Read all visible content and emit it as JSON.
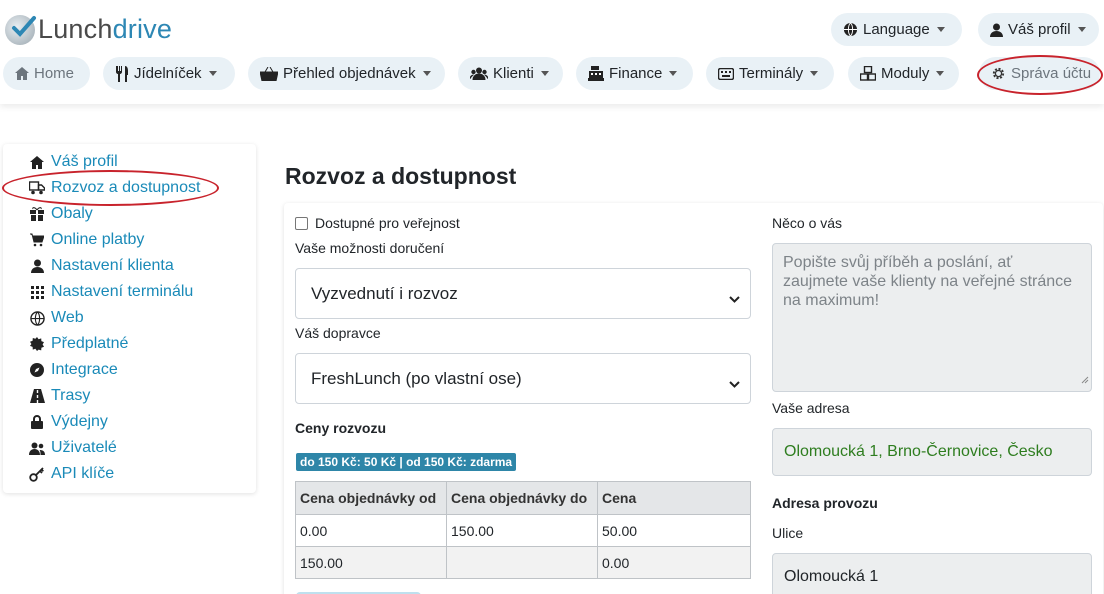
{
  "logo": {
    "part1": "Lunch",
    "part2": "drive"
  },
  "header": {
    "language": "Language",
    "profile": "Váš profil"
  },
  "nav": {
    "home": "Home",
    "menu": "Jídelníček",
    "orders": "Přehled objednávek",
    "clients": "Klienti",
    "finance": "Finance",
    "terminals": "Terminály",
    "modules": "Moduly",
    "account": "Správa účtu"
  },
  "sidebar": {
    "items": [
      {
        "label": "Váš profil",
        "icon": "home-icon"
      },
      {
        "label": "Rozvoz a dostupnost",
        "icon": "truck-icon"
      },
      {
        "label": "Obaly",
        "icon": "box-icon"
      },
      {
        "label": "Online platby",
        "icon": "cart-icon"
      },
      {
        "label": "Nastavení klienta",
        "icon": "user-icon"
      },
      {
        "label": "Nastavení terminálu",
        "icon": "grid-icon"
      },
      {
        "label": "Web",
        "icon": "globe-icon"
      },
      {
        "label": "Předplatné",
        "icon": "certificate-icon"
      },
      {
        "label": "Integrace",
        "icon": "compass-icon"
      },
      {
        "label": "Trasy",
        "icon": "road-icon"
      },
      {
        "label": "Výdejny",
        "icon": "lock-icon"
      },
      {
        "label": "Uživatelé",
        "icon": "users-icon"
      },
      {
        "label": "API klíče",
        "icon": "key-icon"
      }
    ]
  },
  "page": {
    "title": "Rozvoz a dostupnost"
  },
  "form": {
    "public_label": "Dostupné pro veřejnost",
    "public_checked": false,
    "delivery_label": "Vaše možnosti doručení",
    "delivery_value": "Vyzvednutí i rozvoz",
    "carrier_label": "Váš dopravce",
    "carrier_value": "FreshLunch (po vlastní ose)",
    "prices_heading": "Ceny rozvozu",
    "prices_badge": "do 150 Kč: 50 Kč | od 150 Kč: zdarma",
    "price_table": {
      "headers": [
        "Cena objednávky od",
        "Cena objednávky do",
        "Cena"
      ],
      "rows": [
        [
          "0.00",
          "150.00",
          "50.00"
        ],
        [
          "150.00",
          "",
          "0.00"
        ]
      ]
    },
    "about_label": "Něco o vás",
    "about_placeholder": "Popište svůj příběh a poslání, ať zaujmete vaše klienty na veřejné stránce na maximum!",
    "address_label": "Vaše adresa",
    "address_value": "Olomoucká 1, Brno-Černovice, Česko",
    "operation_heading": "Adresa provozu",
    "street_label": "Ulice",
    "street_value": "Olomoucká 1"
  },
  "colors": {
    "brand": "#2d87b4",
    "link": "#1a8ab8",
    "pill_bg": "#e9f1f6",
    "annotation": "#c8232c",
    "badge": "#2e86a8",
    "address_text": "#2e7d1f"
  }
}
